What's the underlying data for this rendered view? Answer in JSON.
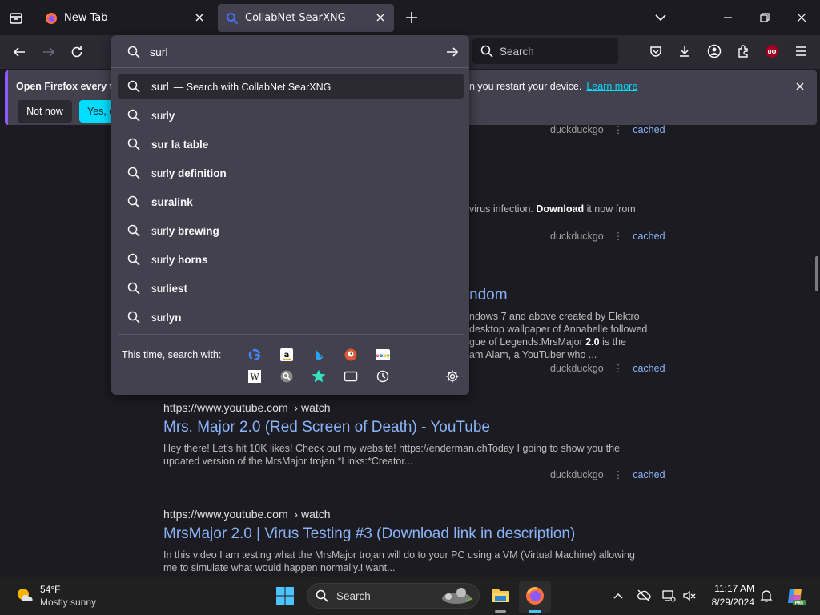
{
  "tabs": [
    {
      "label": "New Tab",
      "active": false
    },
    {
      "label": "CollabNet SearXNG",
      "active": true
    }
  ],
  "toolbar": {
    "search_placeholder": "Search"
  },
  "notification": {
    "text_bold": "Open Firefox every ti",
    "text_tail": "n you restart your device.",
    "link": "Learn more",
    "not_now": "Not now",
    "yes": "Yes, c"
  },
  "urlbar": {
    "value": "surl"
  },
  "suggestions": [
    {
      "typed": "surl",
      "completion": "",
      "action": "— Search with CollabNet SearXNG",
      "selected": true
    },
    {
      "typed": "surl",
      "completion": "y"
    },
    {
      "typed": "",
      "completion": "sur la table"
    },
    {
      "typed": "surl",
      "completion": "y definition"
    },
    {
      "typed": "",
      "completion": "suralink"
    },
    {
      "typed": "surl",
      "completion": "y brewing"
    },
    {
      "typed": "surl",
      "completion": "y horns"
    },
    {
      "typed": "surl",
      "completion": "iest"
    },
    {
      "typed": "surl",
      "completion": "yn"
    }
  ],
  "onetime": {
    "label": "This time, search with:",
    "engines": [
      "google-icon",
      "amazon-icon",
      "bing-icon",
      "duckduckgo-icon",
      "ebay-icon",
      "wikipedia-icon",
      "searxng-icon",
      "bookmarks-icon",
      "tabs-icon",
      "history-icon"
    ]
  },
  "results": {
    "frag1_meta_engine": "duckduckgo",
    "frag1_cached": "cached",
    "frag2_snippet_pre": "virus infection. ",
    "frag2_snippet_bold": "Download",
    "frag2_snippet_post": " it now from",
    "frag2_engine": "duckduckgo",
    "frag2_cached": "cached",
    "frag3_title": "ndom",
    "frag3_line1": "ndows 7 and above created by Elektro",
    "frag3_line2": "desktop wallpaper of Annabelle followed",
    "frag3_line3_pre": "gue of Legends.MrsMajor ",
    "frag3_line3_bold": "2.0",
    "frag3_line3_post": " is the",
    "frag3_line4": "am Alam, a YouTuber who ...",
    "frag3_engine": "duckduckgo",
    "frag3_cached": "cached",
    "r4_url": "https://www.youtube.com",
    "r4_path": "› watch",
    "r4_title": "Mrs. Major 2.0 (Red Screen of Death) - YouTube",
    "r4_snip1": "Hey there! Let's hit 10K likes! Check out my website! https://enderman.chToday I going to show you the",
    "r4_snip2": "updated version of the MrsMajor trojan.*Links:*Creator...",
    "r4_engine": "duckduckgo",
    "r4_cached": "cached",
    "r5_url": "https://www.youtube.com",
    "r5_path": "› watch",
    "r5_title": "MrsMajor 2.0 | Virus Testing #3 (Download link in description)",
    "r5_snip1": "In this video I am testing what the MrsMajor trojan will do to your PC using a VM (Virtual Machine) allowing",
    "r5_snip2": "me to simulate what would happen normally.I want..."
  },
  "taskbar": {
    "weather_temp": "54°F",
    "weather_desc": "Mostly sunny",
    "search_placeholder": "Search",
    "time": "11:17 AM",
    "date": "8/29/2024"
  }
}
